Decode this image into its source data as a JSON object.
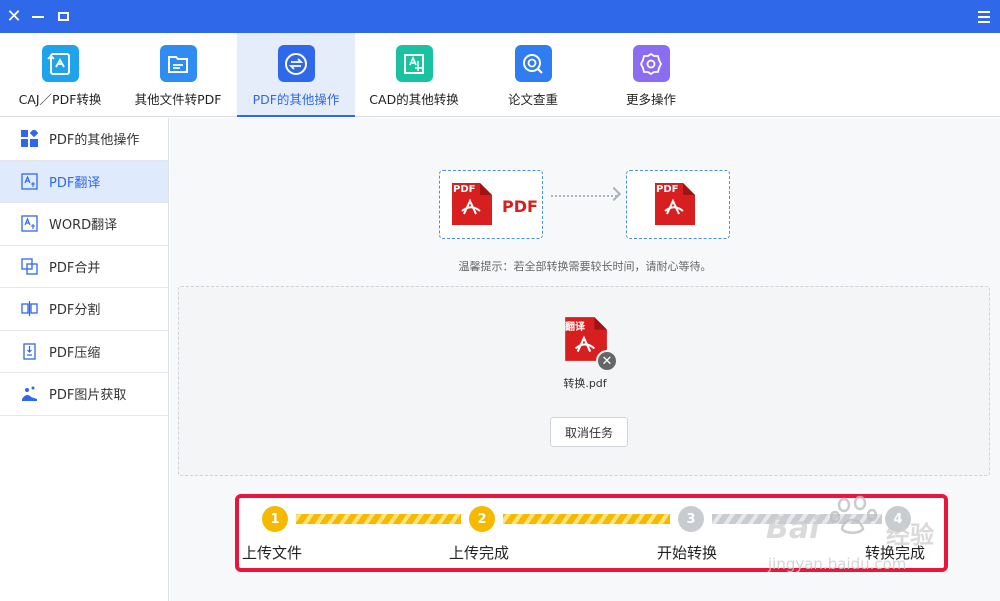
{
  "window": {
    "close_icon": "close-icon",
    "minimize_icon": "minimize-icon",
    "maximize_icon": "maximize-icon",
    "menu_icon": "hamburger-menu-icon",
    "title_bar_color": "#2f68e8"
  },
  "toolbar": {
    "items": [
      {
        "label": "CAJ／PDF转换",
        "icon": "convert-icon",
        "color": "#1fa3ec",
        "active": false
      },
      {
        "label": "其他文件转PDF",
        "icon": "folder-icon",
        "color": "#2f8cf0",
        "active": false
      },
      {
        "label": "PDF的其他操作",
        "icon": "swap-arrows-icon",
        "color": "#2f68e8",
        "active": true
      },
      {
        "label": "CAD的其他转换",
        "icon": "cad-icon",
        "color": "#19c2a0",
        "active": false
      },
      {
        "label": "论文查重",
        "icon": "search-check-icon",
        "color": "#2f7df0",
        "active": false
      },
      {
        "label": "更多操作",
        "icon": "gear-icon",
        "color": "#8b6df2",
        "active": false
      }
    ]
  },
  "sidebar": {
    "items": [
      {
        "label": "PDF的其他操作",
        "icon": "grid-icon",
        "active": false
      },
      {
        "label": "PDF翻译",
        "icon": "translate-icon",
        "active": true
      },
      {
        "label": "WORD翻译",
        "icon": "translate-icon",
        "active": false
      },
      {
        "label": "PDF合并",
        "icon": "merge-icon",
        "active": false
      },
      {
        "label": "PDF分割",
        "icon": "split-icon",
        "active": false
      },
      {
        "label": "PDF压缩",
        "icon": "compress-icon",
        "active": false
      },
      {
        "label": "PDF图片获取",
        "icon": "image-extract-icon",
        "active": false
      }
    ]
  },
  "main": {
    "illustration": {
      "source_badge": "PDF",
      "source_label": "PDF",
      "target_badge": "PDF"
    },
    "tip": "温馨提示：若全部转换需要较长时间，请耐心等待。",
    "file": {
      "badge": "翻译",
      "name": "转换.pdf"
    },
    "cancel_label": "取消任务"
  },
  "progress": {
    "steps": [
      {
        "number": "1",
        "label": "上传文件",
        "done": true
      },
      {
        "number": "2",
        "label": "上传完成",
        "done": true
      },
      {
        "number": "3",
        "label": "开始转换",
        "done": false
      },
      {
        "number": "4",
        "label": "转换完成",
        "done": false
      }
    ],
    "highlight_color": "#e8163a",
    "done_color": "#f5b900"
  },
  "watermark": {
    "brand": "Bai",
    "brand2": "经验",
    "url": "jingyan.baidu.com"
  }
}
